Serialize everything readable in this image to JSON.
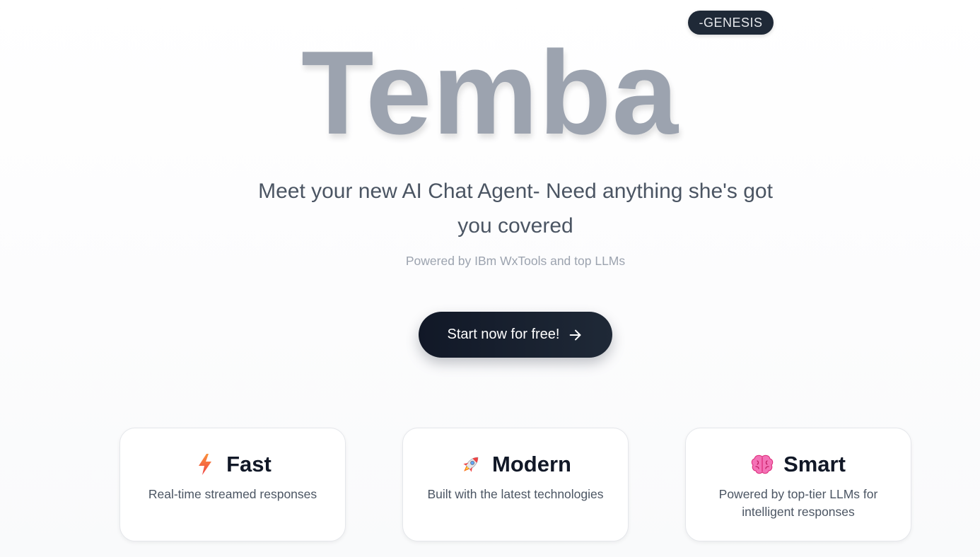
{
  "badge": {
    "label": "-GENESIS"
  },
  "hero": {
    "title": "Temba",
    "tagline": "Meet your new AI Chat Agent- Need anything she's got you covered",
    "powered_by": "Powered by IBm WxTools and top LLMs"
  },
  "cta": {
    "label": "Start now for free!",
    "icon": "arrow-right-icon"
  },
  "features": [
    {
      "icon": "lightning-icon",
      "title": "Fast",
      "description": "Real-time streamed responses"
    },
    {
      "icon": "rocket-icon",
      "title": "Modern",
      "description": "Built with the latest technologies"
    },
    {
      "icon": "brain-icon",
      "title": "Smart",
      "description": "Powered by top-tier LLMs for intelligent responses"
    }
  ],
  "colors": {
    "logo": "#9ca3af",
    "cta_bg": "#111827",
    "badge_bg": "#1f2937",
    "text_muted": "#4b5563"
  }
}
